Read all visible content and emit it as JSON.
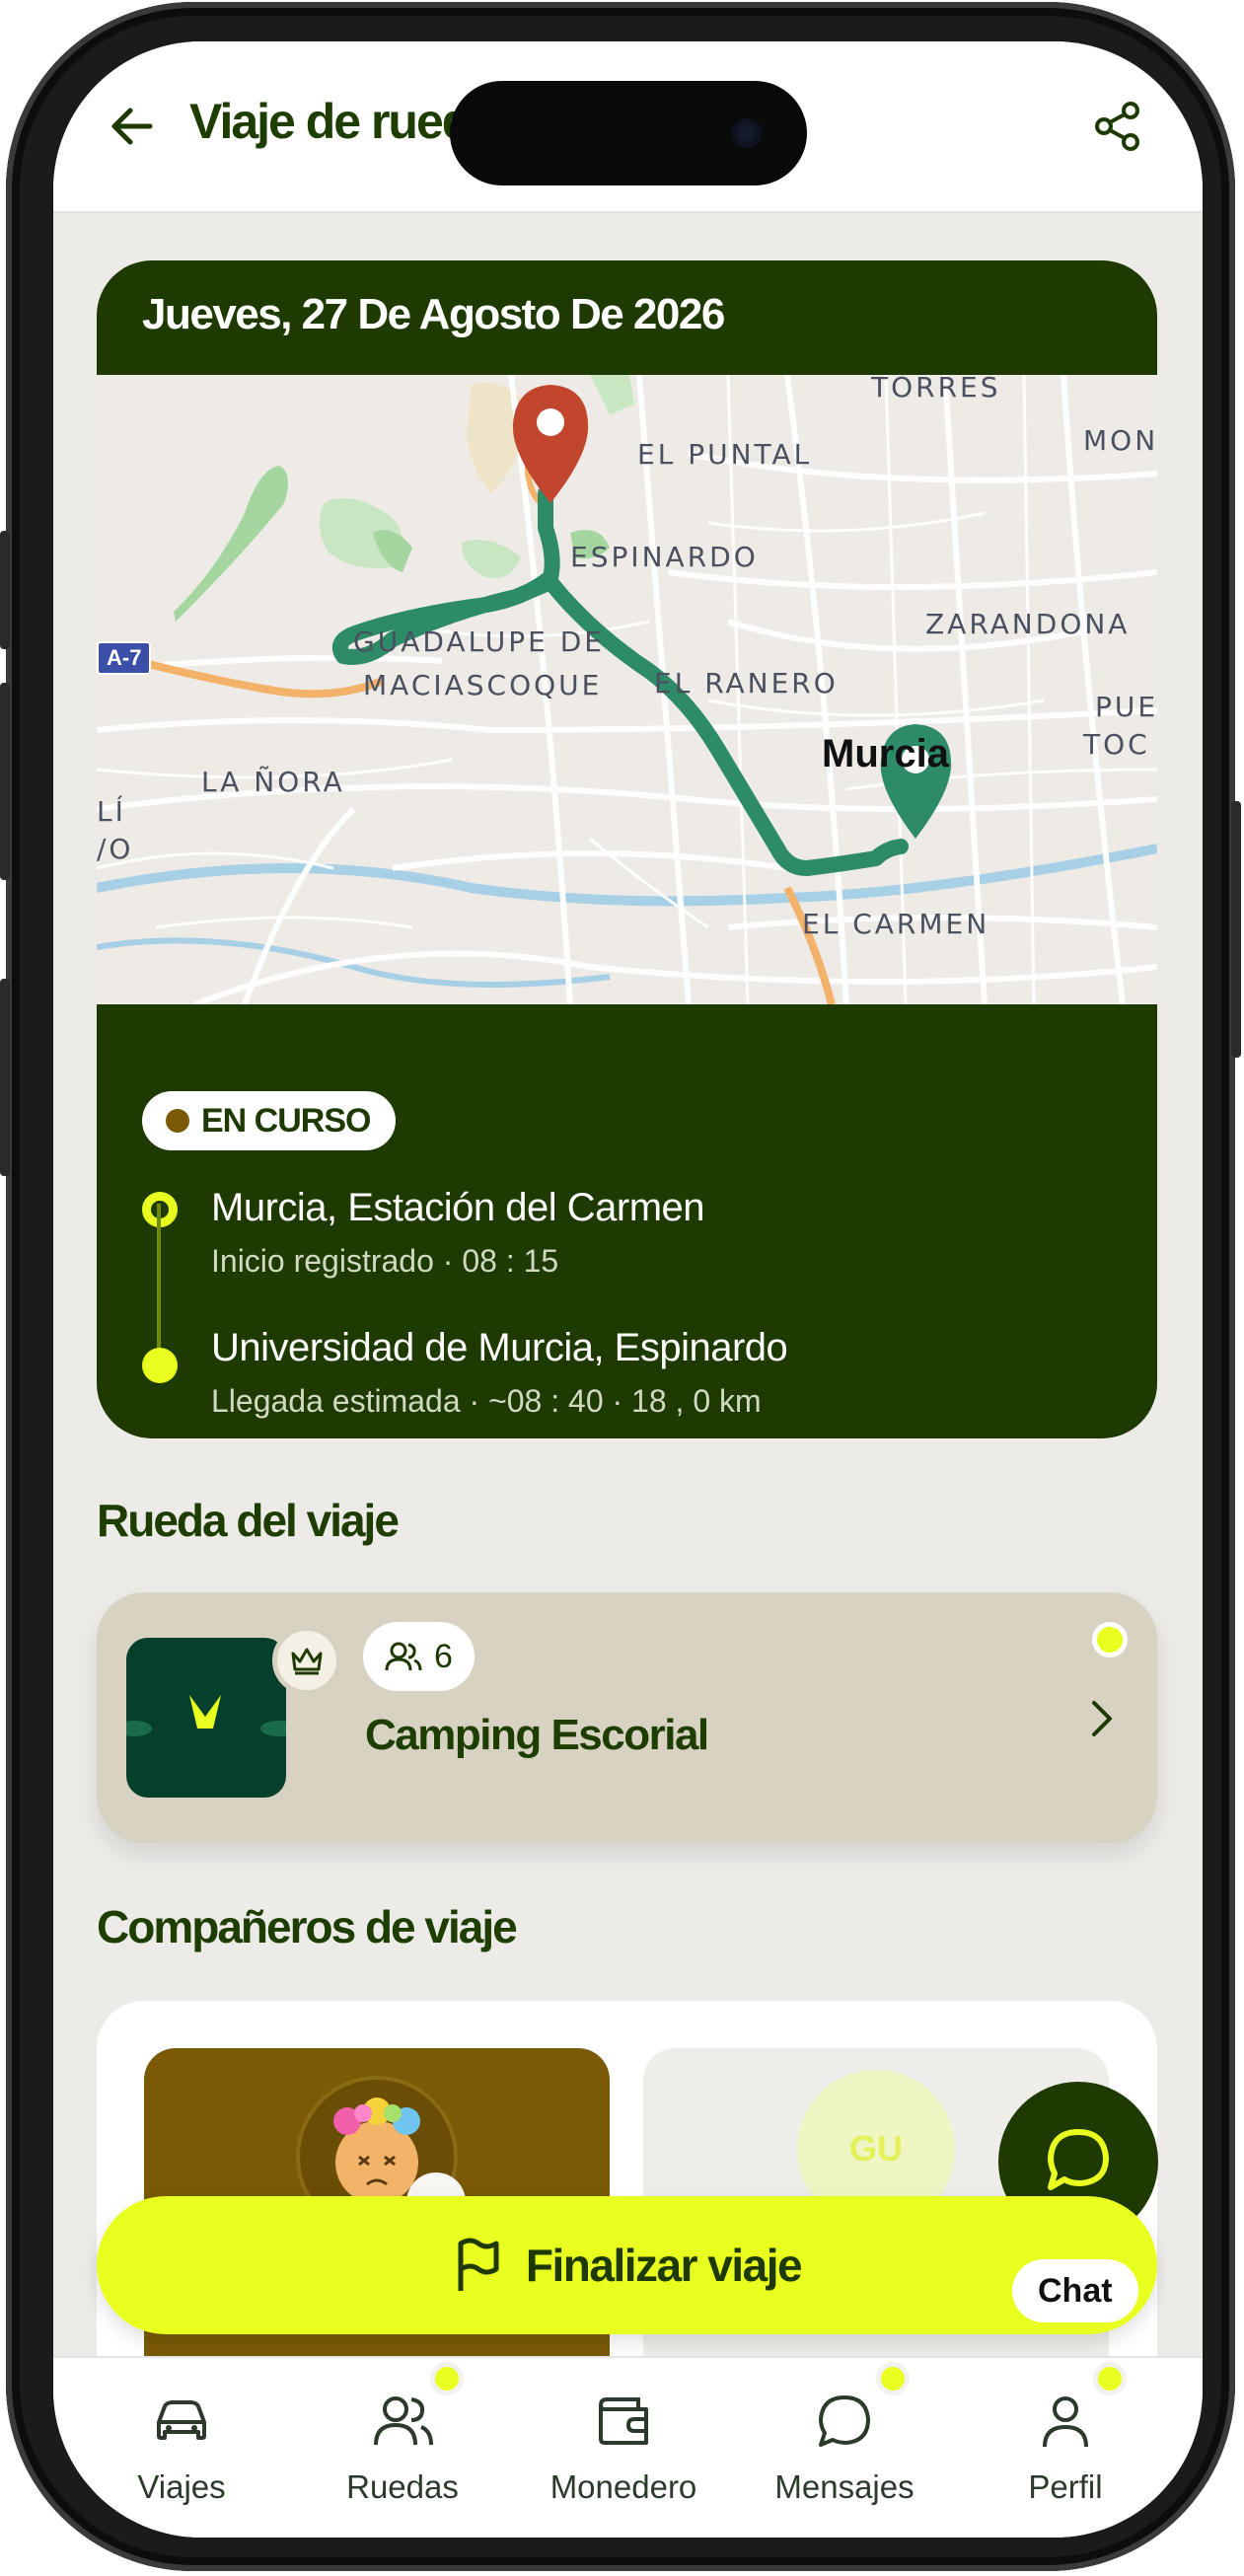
{
  "header": {
    "title": "Viaje de rueda",
    "back_icon": "arrow-left-icon",
    "share_icon": "share-icon"
  },
  "trip": {
    "date": "Jueves, 27 De Agosto De 2026",
    "status": "EN CURSO",
    "origin": {
      "name": "Murcia, Estación del Carmen",
      "detail": "Inicio registrado · 08 : 15"
    },
    "destination": {
      "name": "Universidad de Murcia, Espinardo",
      "detail": "Llegada estimada · ~08 : 40 · 18 , 0 km"
    }
  },
  "map": {
    "labels": {
      "torres": "TORRES",
      "el_puntal": "EL PUNTAL",
      "mon": "MON",
      "espinardo": "ESPINARDO",
      "zarandona": "ZARANDONA",
      "guadalupe": "GUADALUPE DE",
      "maciascoque": "MACIASCOQUE",
      "el_ranero": "EL RANERO",
      "pue": "PUE",
      "toc": "TOC",
      "la_nora": "LA ÑORA",
      "li": "LÍ",
      "vo": "/O",
      "el_carmen": "EL CARMEN",
      "murcia": "Murcia",
      "road": "A-7"
    },
    "colors": {
      "route": "#2e8b67",
      "origin_pin": "#2e8b67",
      "destination_pin": "#c2462e"
    }
  },
  "rueda": {
    "section_title": "Rueda del viaje",
    "name": "Camping Escorial",
    "members": "6",
    "crown_icon": "crown-icon",
    "members_icon": "users-icon",
    "chevron_icon": "chevron-right-icon"
  },
  "companions": {
    "section_title": "Compañeros de viaje",
    "initials": "GU"
  },
  "actions": {
    "finish": "Finalizar viaje",
    "chat": "Chat"
  },
  "nav": [
    {
      "label": "Viajes",
      "icon": "car-icon"
    },
    {
      "label": "Ruedas",
      "icon": "users-icon"
    },
    {
      "label": "Monedero",
      "icon": "wallet-icon"
    },
    {
      "label": "Mensajes",
      "icon": "chat-icon"
    },
    {
      "label": "Perfil",
      "icon": "person-icon"
    }
  ],
  "theme": {
    "dark_green": "#1e3a00",
    "lime": "#e8ff1f",
    "background": "#ecebe8"
  }
}
